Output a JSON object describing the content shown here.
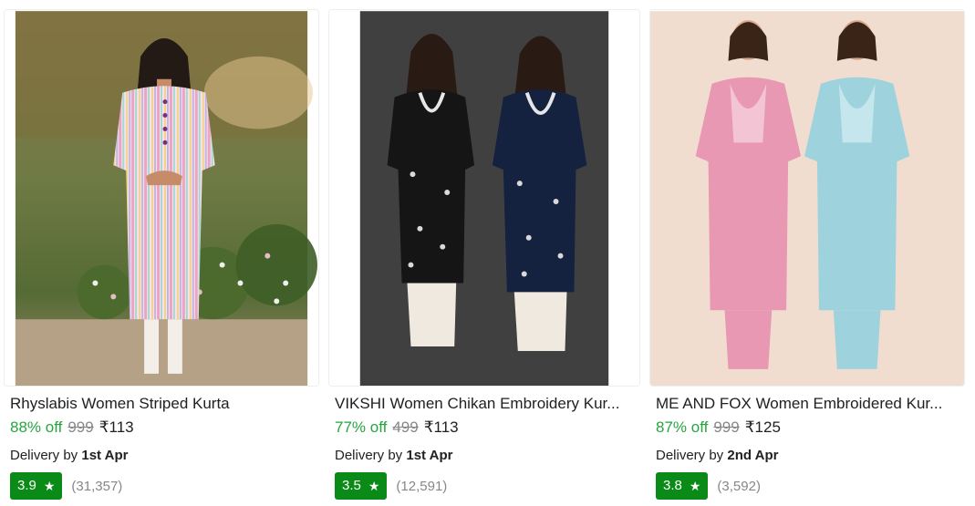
{
  "products": [
    {
      "title": "Rhyslabis Women Striped Kurta",
      "discount": "88% off",
      "mrp": "999",
      "price": "₹113",
      "delivery_prefix": "Delivery by",
      "delivery_date": "1st Apr",
      "rating": "3.9",
      "rating_count": "(31,357)"
    },
    {
      "title": "VIKSHI Women Chikan Embroidery Kur...",
      "discount": "77% off",
      "mrp": "499",
      "price": "₹113",
      "delivery_prefix": "Delivery by",
      "delivery_date": "1st Apr",
      "rating": "3.5",
      "rating_count": "(12,591)"
    },
    {
      "title": "ME AND FOX Women Embroidered Kur...",
      "discount": "87% off",
      "mrp": "999",
      "price": "₹125",
      "delivery_prefix": "Delivery by",
      "delivery_date": "2nd Apr",
      "rating": "3.8",
      "rating_count": "(3,592)"
    }
  ],
  "icons": {
    "rating": "star-icon"
  },
  "colors": {
    "discount": "#26a541",
    "rating_badge": "#0a8a16",
    "muted": "#878787"
  }
}
